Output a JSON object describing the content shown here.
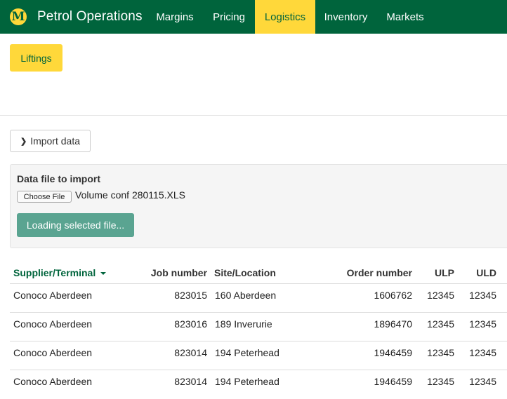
{
  "navbar": {
    "logo_letter": "M",
    "brand": "Petrol Operations",
    "items": [
      {
        "label": "Margins",
        "active": false
      },
      {
        "label": "Pricing",
        "active": false
      },
      {
        "label": "Logistics",
        "active": true
      },
      {
        "label": "Inventory",
        "active": false
      },
      {
        "label": "Markets",
        "active": false
      }
    ]
  },
  "subnav": {
    "active_tab": "Liftings"
  },
  "import": {
    "toggle_label": "Import data",
    "panel_label": "Data file to import",
    "choose_file_label": "Choose File",
    "file_name": "Volume conf 280115.XLS",
    "loading_label": "Loading selected file..."
  },
  "table": {
    "columns": [
      "Supplier/Terminal",
      "Job number",
      "Site/Location",
      "Order number",
      "ULP",
      "ULD"
    ],
    "sorted_by": "Supplier/Terminal",
    "rows": [
      [
        "Conoco Aberdeen",
        "823015",
        "160 Aberdeen",
        "1606762",
        "12345",
        "12345"
      ],
      [
        "Conoco Aberdeen",
        "823016",
        "189 Inverurie",
        "1896470",
        "12345",
        "12345"
      ],
      [
        "Conoco Aberdeen",
        "823014",
        "194 Peterhead",
        "1946459",
        "12345",
        "12345"
      ],
      [
        "Conoco Aberdeen",
        "823014",
        "194 Peterhead",
        "1946459",
        "12345",
        "12345"
      ]
    ]
  },
  "colors": {
    "brand_green": "#00643c",
    "accent_yellow": "#ffd83a",
    "loading_button": "#5aa491"
  }
}
